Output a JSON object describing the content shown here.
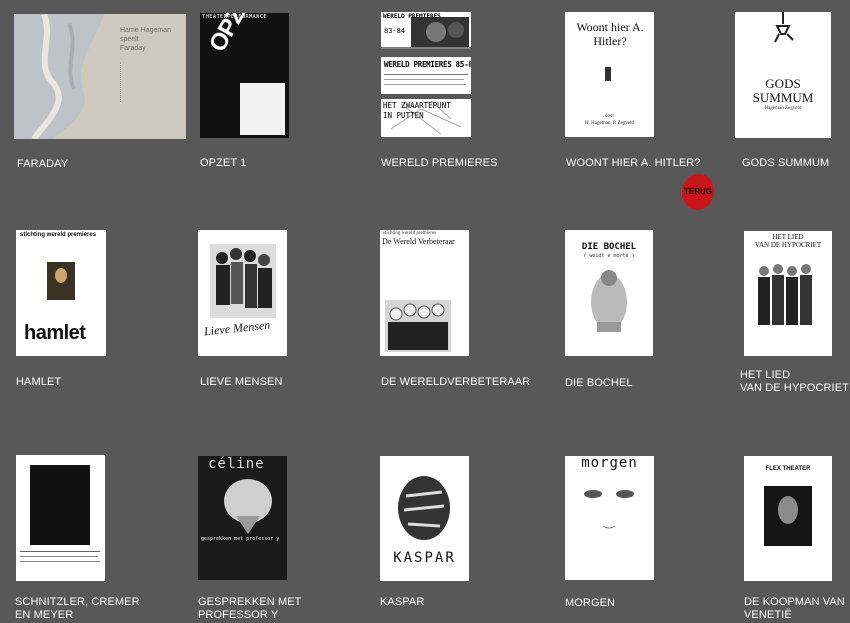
{
  "posters": {
    "faraday": {
      "caption": "FARADAY",
      "lines": [
        "Hame Hageman",
        "speelt",
        "Faraday"
      ]
    },
    "opzet": {
      "caption": "OPZET 1",
      "header": "THEATERPERFORMANCE",
      "title": "OPZET"
    },
    "wereld": {
      "caption": "WERELD PREMIERES",
      "top_banner": "WERELD PREMIERES",
      "top_years": "83-84",
      "mid_banner": "WERELD PREMIERES 85-86",
      "bottom_banner": "HET ZWAARTEPUNT IN PUTTEN"
    },
    "hitler": {
      "caption": "WOONT HIER A. HITLER?",
      "title": "Woont hier A. Hitler?",
      "by": "door",
      "authors": "H. Hageman, P. Zegveld"
    },
    "gods": {
      "caption": "GODS SUMMUM",
      "title_line1": "GODS",
      "title_line2": "SUMMUM",
      "subtitle": "Hageman Zegveld"
    },
    "hamlet": {
      "caption": "HAMLET",
      "org": "stichting wereld premieres",
      "title": "hamlet"
    },
    "lieve": {
      "caption": "LIEVE MENSEN",
      "title": "Lieve Mensen"
    },
    "verbeteraar": {
      "caption": "DE WERELDVERBETERAAR",
      "org": "stichting wereld premieres",
      "title": "De Wereld Verbeteraar"
    },
    "bochel": {
      "caption": "DIE BOCHEL",
      "title": "DIE BOCHEL",
      "subtitle": "( weidt e morte )"
    },
    "hypocriet": {
      "caption_line1": "HET LIED",
      "caption_line2": "VAN DE HYPOCRIET",
      "title_line1": "HET LIED",
      "title_line2": "VAN DE HYPOCRIET"
    },
    "schnitzler": {
      "caption_line1": "SCHNITZLER, CREMER",
      "caption_line2": "EN MEYER"
    },
    "celine": {
      "caption_line1": "GESPREKKEN MET",
      "caption_line2": "PROFESSOR Y",
      "title": "céline",
      "subtitle": "gesprekken met professor y"
    },
    "kaspar": {
      "caption": "KASPAR",
      "title": "KASPAR"
    },
    "morgen": {
      "caption": "MORGEN",
      "title": "morgen"
    },
    "koopman": {
      "caption_line1": "DE KOOPMAN VAN",
      "caption_line2": "VENETIË",
      "header": "FLEX THEATER"
    }
  },
  "terug": {
    "label": "TERUG",
    "color": "#c8161c"
  },
  "colors": {
    "background": "#585858",
    "caption": "#ffffff"
  }
}
